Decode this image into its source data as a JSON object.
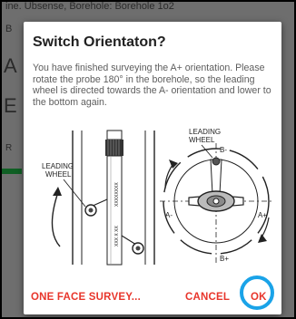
{
  "background": {
    "header_text": "ine. Ubsense, Borehole: Borehole 1o2",
    "letters": [
      "B",
      "A",
      "E",
      "R"
    ]
  },
  "dialog": {
    "title": "Switch Orientaton?",
    "message": "You have finished surveying the A+ orientation. Please rotate the probe 180° in the borehole, so the leading wheel is directed towards the A- orientation and lower to the bottom again.",
    "illustration": {
      "left_label_line1": "LEADING",
      "left_label_line2": "WHEEL",
      "right_label_line1": "LEADING",
      "right_label_line2": "WHEEL",
      "axis_b_minus": "B-",
      "axis_a_minus": "A-",
      "axis_a_plus": "A+",
      "axis_b_plus": "B+"
    },
    "buttons": {
      "one_face": "ONE FACE SURVEY...",
      "cancel": "CANCEL",
      "ok": "OK"
    }
  },
  "colors": {
    "accent_red": "#e8352b",
    "highlight_ring": "#1aa3e8",
    "scrim": "#6e6e6e"
  }
}
